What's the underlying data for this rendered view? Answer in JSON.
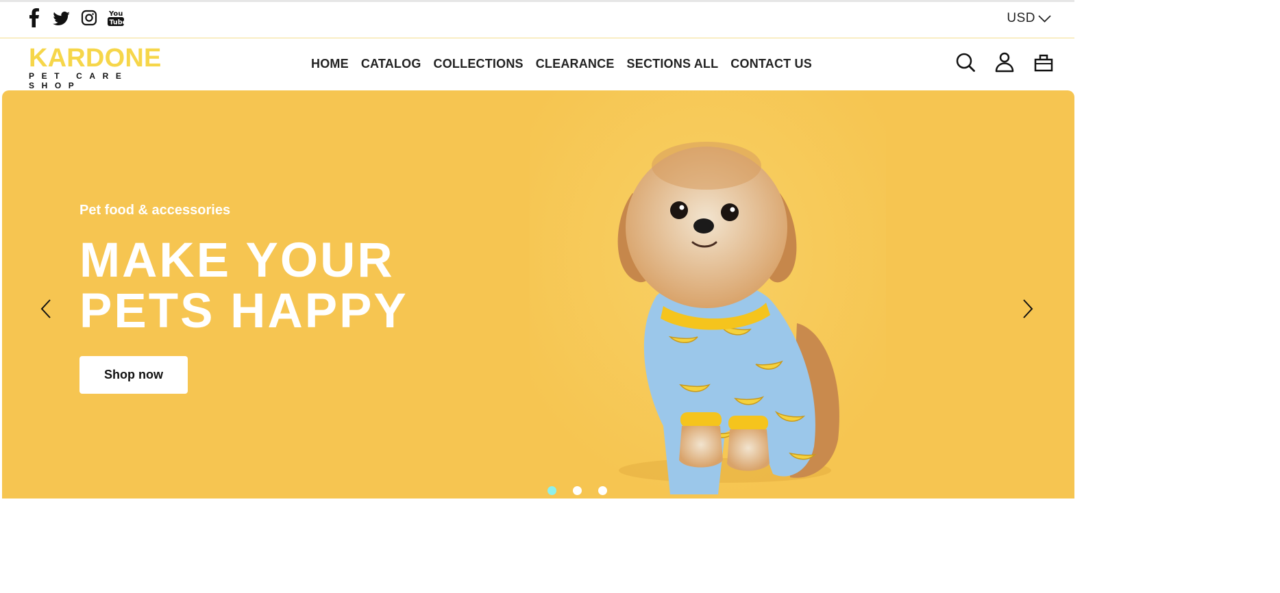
{
  "topbar": {
    "social": [
      {
        "name": "facebook-icon"
      },
      {
        "name": "twitter-icon"
      },
      {
        "name": "instagram-icon"
      },
      {
        "name": "youtube-icon"
      }
    ],
    "currency": "USD",
    "accent_line_color": "#f3dd8a"
  },
  "logo": {
    "name": "KARDONE",
    "tagline": "PET CARE SHOP",
    "color": "#f6d64a"
  },
  "nav": [
    "HOME",
    "CATALOG",
    "COLLECTIONS",
    "CLEARANCE",
    "SECTIONS ALL",
    "CONTACT US"
  ],
  "header_icons": [
    "search-icon",
    "account-icon",
    "cart-icon"
  ],
  "hero": {
    "background": "#f6c551",
    "kicker": "Pet food & accessories",
    "headline_line1": "MAKE YOUR",
    "headline_line2": "PETS HAPPY",
    "cta": "Shop now",
    "slide_count": 3,
    "active_slide": 1,
    "active_dot_color": "#8df0ec"
  }
}
